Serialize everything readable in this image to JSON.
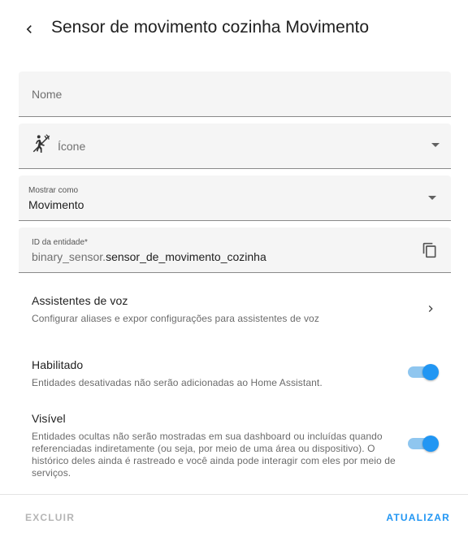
{
  "header": {
    "back_icon": "chevron-left-icon",
    "title": "Sensor de movimento cozinha Movimento"
  },
  "form": {
    "name_field": {
      "placeholder": "Nome",
      "value": ""
    },
    "icon_field": {
      "placeholder": "Ícone",
      "icon": "motion-sensor-icon"
    },
    "display_as": {
      "label": "Mostrar como",
      "value": "Movimento"
    },
    "entity_id": {
      "label": "ID da entidade*",
      "prefix": "binary_sensor.",
      "value": "sensor_de_movimento_cozinha",
      "copy_icon": "copy-icon"
    }
  },
  "voice_assistants": {
    "title": "Assistentes de voz",
    "description": "Configurar aliases e expor configurações para assistentes de voz"
  },
  "enabled": {
    "title": "Habilitado",
    "description": "Entidades desativadas não serão adicionadas ao Home Assistant.",
    "on": true
  },
  "visible": {
    "title": "Visível",
    "description": "Entidades ocultas não serão mostradas em sua dashboard ou incluídas quando referenciadas indiretamente (ou seja, por meio de uma área ou dispositivo). O histórico deles ainda é rastreado e você ainda pode interagir com eles por meio de serviços.",
    "on": true
  },
  "footer": {
    "delete_label": "EXCLUIR",
    "update_label": "ATUALIZAR"
  },
  "colors": {
    "accent": "#2196f3",
    "field_bg": "#f5f5f5",
    "disabled_text": "#b5b5b5"
  }
}
